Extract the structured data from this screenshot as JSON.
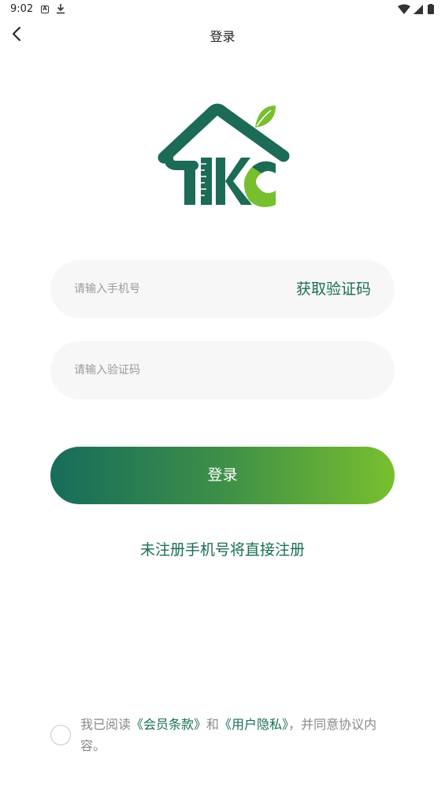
{
  "status_bar": {
    "time": "9:02",
    "icons": [
      "notification-a-icon",
      "download-icon",
      "wifi-icon",
      "signal-icon",
      "battery-icon"
    ]
  },
  "nav": {
    "title": "登录",
    "back_icon": "chevron-left-icon"
  },
  "logo": {
    "text": "TKC",
    "colors": {
      "dark": "#1b6b56",
      "light": "#77bf2f"
    }
  },
  "form": {
    "phone_placeholder": "请输入手机号",
    "phone_value": "",
    "get_code_label": "获取验证码",
    "code_placeholder": "请输入验证码",
    "code_value": "",
    "login_label": "登录",
    "register_hint": "未注册手机号将直接注册"
  },
  "agreement": {
    "checked": false,
    "prefix": "我已阅读",
    "terms_link": "《会员条款》",
    "and": "和",
    "privacy_link": "《用户隐私》",
    "suffix": "，并同意协议内容。"
  },
  "colors": {
    "accent": "#1a6e54",
    "gradient_start": "#166c5a",
    "gradient_end": "#78bf2e",
    "field_bg": "#f7f7f7",
    "placeholder": "#9a9a9a"
  }
}
